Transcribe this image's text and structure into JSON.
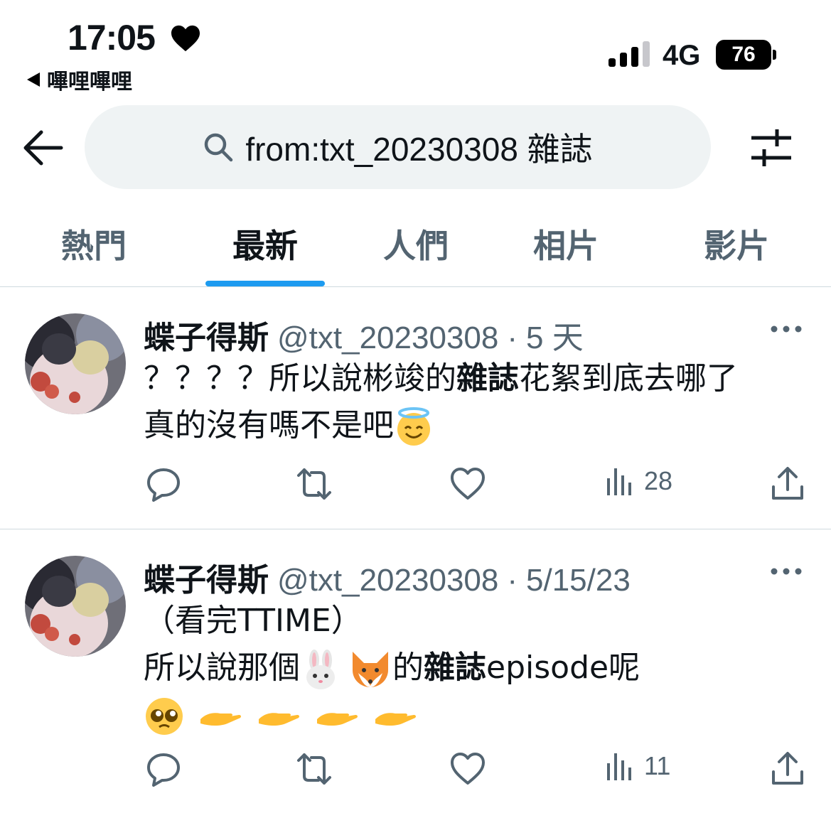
{
  "status_bar": {
    "time": "17:05",
    "back_app": "嗶哩嗶哩",
    "network": "4G",
    "battery": "76"
  },
  "search": {
    "query": "from:txt_20230308 雜誌"
  },
  "tabs": [
    {
      "label": "熱門"
    },
    {
      "label": "最新",
      "active": true
    },
    {
      "label": "人們"
    },
    {
      "label": "相片"
    },
    {
      "label": "影片"
    }
  ],
  "tweets": [
    {
      "name": "蝶子得斯",
      "handle": "@txt_20230308",
      "separator": "·",
      "time": "5 天",
      "text_parts": [
        "？？？？所以說彬竣的",
        "雜誌",
        "花絮到底去哪了",
        "真的沒有嗎不是吧"
      ],
      "views": "28"
    },
    {
      "name": "蝶子得斯",
      "handle": "@txt_20230308",
      "separator": "·",
      "time": "5/15/23",
      "text_parts": [
        "（看完TTIME）",
        "所以說那個",
        "的",
        "雜誌",
        "episode呢"
      ],
      "views": "11"
    }
  ],
  "icons": {
    "status": [
      "heart-icon",
      "signal-icon",
      "battery-icon"
    ],
    "header": [
      "back-arrow-icon",
      "search-icon",
      "filter-icon"
    ],
    "tweet_actions": [
      "reply-icon",
      "retweet-icon",
      "like-icon",
      "views-icon",
      "share-icon"
    ],
    "emoji": [
      "halo-smile-emoji",
      "rabbit-emoji",
      "fox-emoji",
      "pleading-face-emoji",
      "palm-up-hand-emoji"
    ]
  },
  "colors": {
    "accent": "#1d9bf0",
    "muted": "#536471",
    "search_bg": "#eff3f4"
  }
}
